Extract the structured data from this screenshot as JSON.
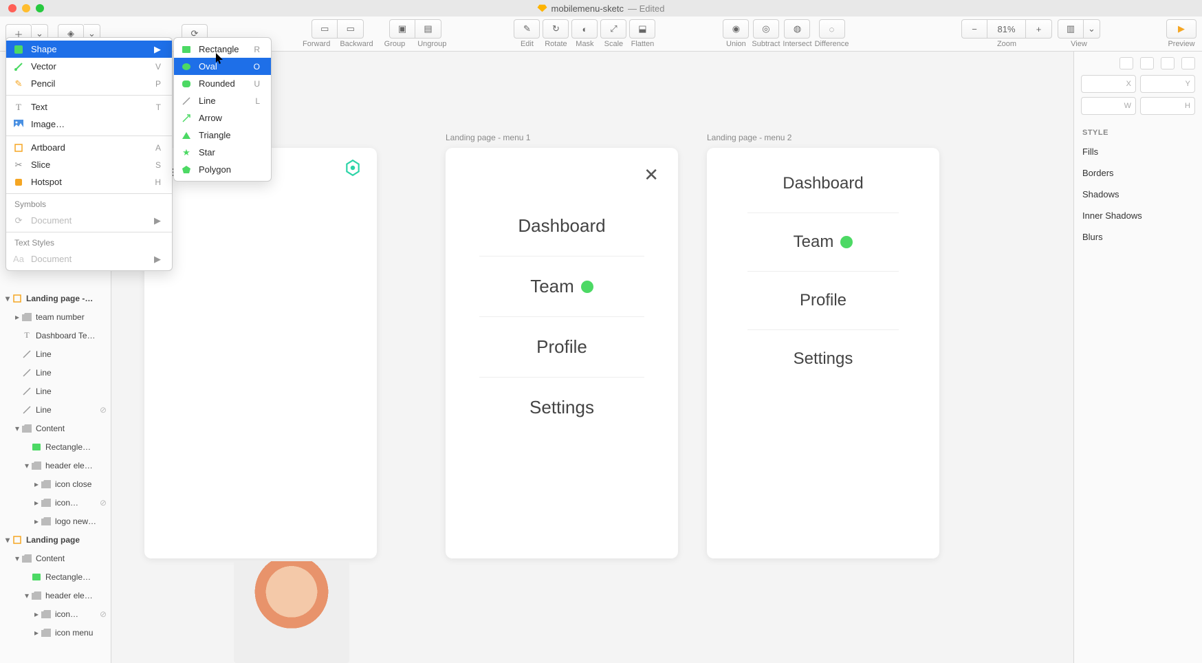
{
  "window": {
    "title": "mobilemenu-sketc",
    "edited_label": "— Edited"
  },
  "toolbar": {
    "edit": "Edit",
    "rotate": "Rotate",
    "mask": "Mask",
    "scale": "Scale",
    "flatten": "Flatten",
    "forward": "Forward",
    "backward": "Backward",
    "group": "Group",
    "ungroup": "Ungroup",
    "union": "Union",
    "subtract": "Subtract",
    "intersect": "Intersect",
    "difference": "Difference",
    "zoom_label": "Zoom",
    "zoom_value": "81%",
    "view_label": "View",
    "preview_label": "Preview"
  },
  "insert_menu": {
    "items": [
      {
        "icon": "shape",
        "label": "Shape",
        "shortcut": "",
        "arrow": true,
        "highlighted": true
      },
      {
        "icon": "vector",
        "label": "Vector",
        "shortcut": "V"
      },
      {
        "icon": "pencil",
        "label": "Pencil",
        "shortcut": "P"
      }
    ],
    "items2": [
      {
        "icon": "text",
        "label": "Text",
        "shortcut": "T"
      },
      {
        "icon": "image",
        "label": "Image…",
        "shortcut": ""
      }
    ],
    "items3": [
      {
        "icon": "artboard",
        "label": "Artboard",
        "shortcut": "A"
      },
      {
        "icon": "slice",
        "label": "Slice",
        "shortcut": "S"
      },
      {
        "icon": "hotspot",
        "label": "Hotspot",
        "shortcut": "H"
      }
    ],
    "symbols_header": "Symbols",
    "symbols_document": "Document",
    "text_styles_header": "Text Styles",
    "text_styles_document": "Document"
  },
  "shape_submenu": [
    {
      "icon": "rect",
      "label": "Rectangle",
      "shortcut": "R"
    },
    {
      "icon": "oval",
      "label": "Oval",
      "shortcut": "O",
      "highlighted": true
    },
    {
      "icon": "rounded",
      "label": "Rounded",
      "shortcut": "U"
    },
    {
      "icon": "line",
      "label": "Line",
      "shortcut": "L"
    },
    {
      "icon": "arrow",
      "label": "Arrow",
      "shortcut": ""
    },
    {
      "icon": "triangle",
      "label": "Triangle",
      "shortcut": ""
    },
    {
      "icon": "star",
      "label": "Star",
      "shortcut": ""
    },
    {
      "icon": "polygon",
      "label": "Polygon",
      "shortcut": ""
    }
  ],
  "layers": [
    {
      "depth": 0,
      "disclosure": "▾",
      "icon": "artboard",
      "label": "Landing page -…",
      "bold": true
    },
    {
      "depth": 1,
      "disclosure": "▸",
      "icon": "folder",
      "label": "team number"
    },
    {
      "depth": 1,
      "disclosure": "",
      "icon": "text",
      "label": "Dashboard Te…"
    },
    {
      "depth": 1,
      "disclosure": "",
      "icon": "line",
      "label": "Line"
    },
    {
      "depth": 1,
      "disclosure": "",
      "icon": "line",
      "label": "Line"
    },
    {
      "depth": 1,
      "disclosure": "",
      "icon": "line",
      "label": "Line"
    },
    {
      "depth": 1,
      "disclosure": "",
      "icon": "line",
      "label": "Line",
      "hidden": true
    },
    {
      "depth": 1,
      "disclosure": "▾",
      "icon": "folder",
      "label": "Content"
    },
    {
      "depth": 2,
      "disclosure": "",
      "icon": "rect",
      "label": "Rectangle…"
    },
    {
      "depth": 2,
      "disclosure": "▾",
      "icon": "folder",
      "label": "header ele…"
    },
    {
      "depth": 3,
      "disclosure": "▸",
      "icon": "folder",
      "label": "icon close"
    },
    {
      "depth": 3,
      "disclosure": "▸",
      "icon": "folder",
      "label": "icon…",
      "hidden": true
    },
    {
      "depth": 3,
      "disclosure": "▸",
      "icon": "folder",
      "label": "logo new…"
    },
    {
      "depth": 0,
      "disclosure": "▾",
      "icon": "artboard",
      "label": "Landing page",
      "bold": true
    },
    {
      "depth": 1,
      "disclosure": "▾",
      "icon": "folder",
      "label": "Content"
    },
    {
      "depth": 2,
      "disclosure": "",
      "icon": "rect",
      "label": "Rectangle…"
    },
    {
      "depth": 2,
      "disclosure": "▾",
      "icon": "folder",
      "label": "header ele…"
    },
    {
      "depth": 3,
      "disclosure": "▸",
      "icon": "folder",
      "label": "icon…",
      "hidden": true
    },
    {
      "depth": 3,
      "disclosure": "▸",
      "icon": "folder",
      "label": "icon menu"
    }
  ],
  "inspector": {
    "style_header": "STYLE",
    "sections": [
      "Fills",
      "Borders",
      "Shadows",
      "Inner Shadows",
      "Blurs"
    ],
    "field_labels": {
      "x": "X",
      "y": "Y",
      "w": "W",
      "h": "H"
    }
  },
  "artboards": {
    "ab0": {
      "label": ""
    },
    "ab1": {
      "label": "Landing page - menu 1",
      "entries": [
        "Dashboard",
        "Team",
        "Profile",
        "Settings"
      ]
    },
    "ab2": {
      "label": "Landing page - menu 2",
      "entries": [
        "Dashboard",
        "Team",
        "Profile",
        "Settings"
      ]
    }
  }
}
